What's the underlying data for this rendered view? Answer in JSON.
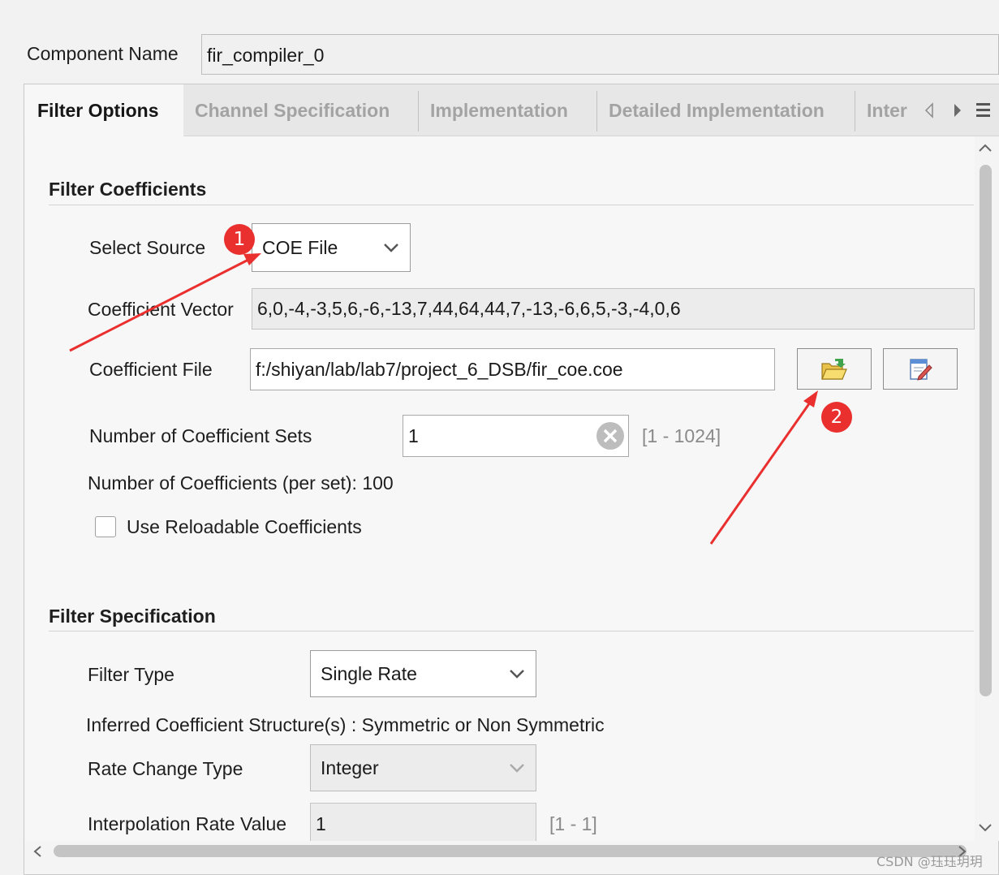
{
  "component": {
    "label": "Component Name",
    "value": "fir_compiler_0"
  },
  "tabs": [
    {
      "label": "Filter Options",
      "active": true
    },
    {
      "label": "Channel Specification",
      "active": false
    },
    {
      "label": "Implementation",
      "active": false
    },
    {
      "label": "Detailed Implementation",
      "active": false
    },
    {
      "label": "Inter",
      "active": false
    }
  ],
  "filter_coefficients": {
    "title": "Filter Coefficients",
    "select_source_label": "Select Source",
    "select_source_value": "COE File",
    "coefficient_vector_label": "Coefficient Vector",
    "coefficient_vector_value": "6,0,-4,-3,5,6,-6,-13,7,44,64,44,7,-13,-6,6,5,-3,-4,0,6",
    "coefficient_file_label": "Coefficient File",
    "coefficient_file_value": "f:/shiyan/lab/lab7/project_6_DSB/fir_coe.coe",
    "num_sets_label": "Number of Coefficient Sets",
    "num_sets_value": "1",
    "num_sets_range": "[1 - 1024]",
    "num_coeffs_text": "Number of Coefficients (per set): 100",
    "reloadable_label": "Use Reloadable Coefficients",
    "reloadable_checked": false
  },
  "filter_specification": {
    "title": "Filter Specification",
    "filter_type_label": "Filter Type",
    "filter_type_value": "Single Rate",
    "inferred_text": "Inferred Coefficient Structure(s) : Symmetric or Non Symmetric",
    "rate_change_label": "Rate Change Type",
    "rate_change_value": "Integer",
    "interp_label": "Interpolation Rate Value",
    "interp_value": "1",
    "interp_range": "[1 - 1]"
  },
  "annotations": {
    "badge1": "1",
    "badge2": "2",
    "color": "#ea2f2f"
  },
  "watermark": "CSDN @珏珏玥玥"
}
